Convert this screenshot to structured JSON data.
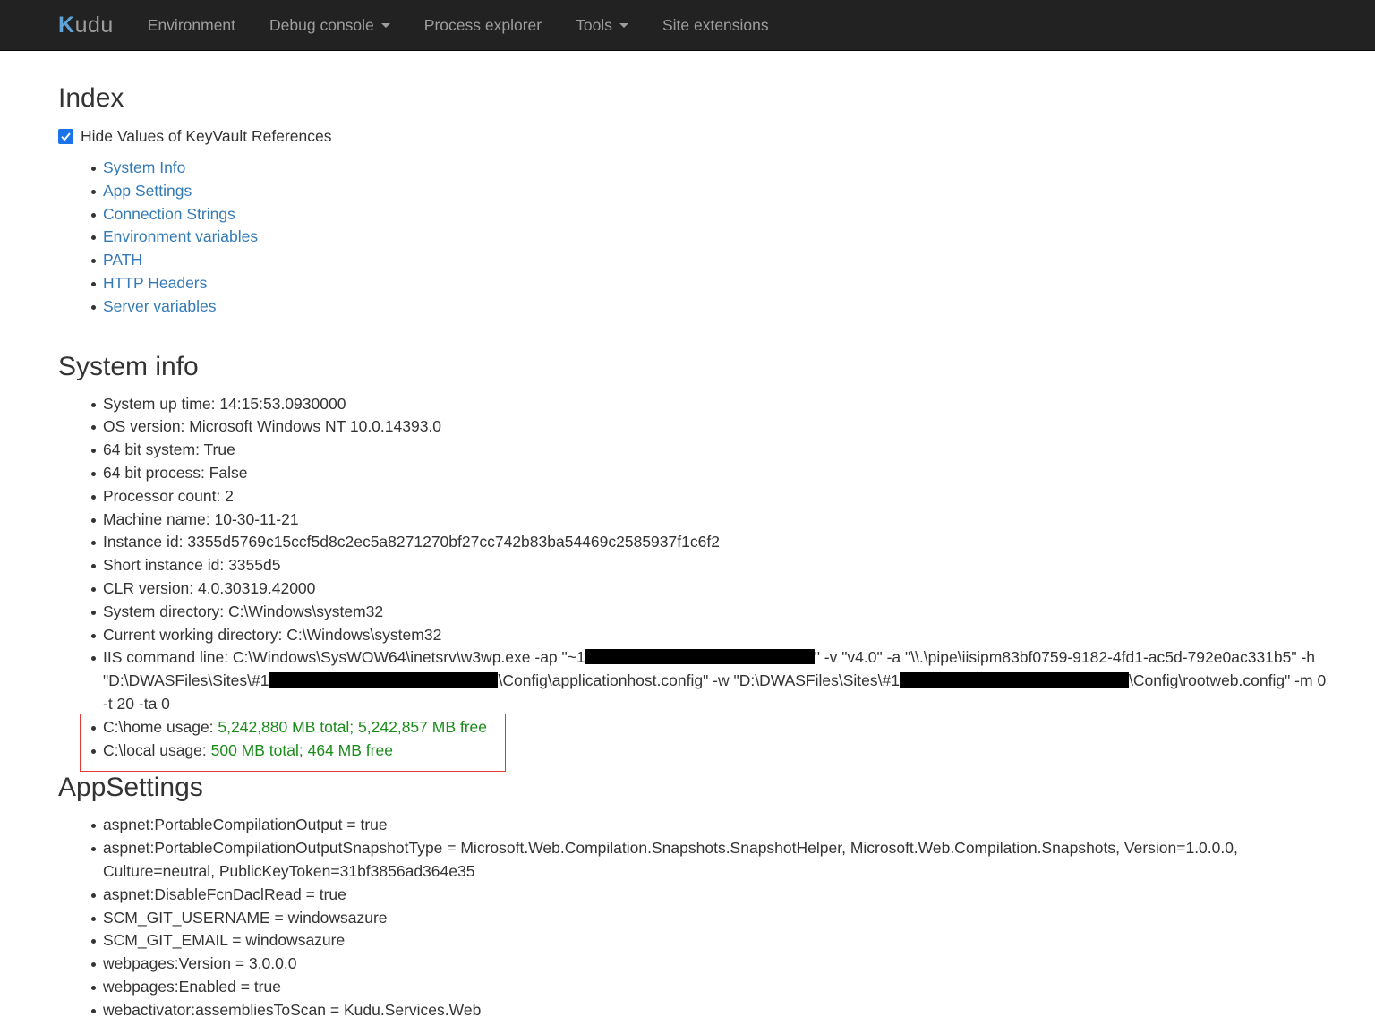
{
  "nav": {
    "brand": "udu",
    "brand_k": "K",
    "items": [
      {
        "label": "Environment",
        "dropdown": false
      },
      {
        "label": "Debug console",
        "dropdown": true
      },
      {
        "label": "Process explorer",
        "dropdown": false
      },
      {
        "label": "Tools",
        "dropdown": true
      },
      {
        "label": "Site extensions",
        "dropdown": false
      }
    ]
  },
  "index": {
    "title": "Index",
    "checkbox_label": "Hide Values of KeyVault References",
    "checkbox_checked": true,
    "links": [
      "System Info",
      "App Settings",
      "Connection Strings",
      "Environment variables",
      "PATH",
      "HTTP Headers",
      "Server variables"
    ]
  },
  "system_info": {
    "title": "System info",
    "items": [
      "System up time: 14:15:53.0930000",
      "OS version: Microsoft Windows NT 10.0.14393.0",
      "64 bit system: True",
      "64 bit process: False",
      "Processor count: 2",
      "Machine name: 10-30-11-21",
      "Instance id: 3355d5769c15ccf5d8c2ec5a8271270bf27cc742b83ba54469c2585937f1c6f2",
      "Short instance id: 3355d5",
      "CLR version: 4.0.30319.42000",
      "System directory: C:\\Windows\\system32",
      "Current working directory: C:\\Windows\\system32"
    ],
    "iis": {
      "p1": "IIS command line: C:\\Windows\\SysWOW64\\inetsrv\\w3wp.exe -ap \"~1",
      "p2": "\" -v \"v4.0\" -a \"\\\\.\\pipe\\iisipm83bf0759-9182-4fd1-ac5d-792e0ac331b5\" -h",
      "p3": "\"D:\\DWASFiles\\Sites\\#1",
      "p4": "\\Config\\applicationhost.config\" -w \"D:\\DWASFiles\\Sites\\#1",
      "p5": "\\Config\\rootweb.config\" -m 0",
      "p6": "-t 20 -ta 0"
    },
    "home_usage": {
      "label": "C:\\home usage: ",
      "value": "5,242,880 MB total; 5,242,857 MB free"
    },
    "local_usage": {
      "label": "C:\\local usage: ",
      "value": "500 MB total; 464 MB free"
    },
    "highlight_color": "#e53935",
    "usage_color": "#198c19"
  },
  "app_settings": {
    "title": "AppSettings",
    "items": [
      "aspnet:PortableCompilationOutput = true",
      "aspnet:PortableCompilationOutputSnapshotType = Microsoft.Web.Compilation.Snapshots.SnapshotHelper, Microsoft.Web.Compilation.Snapshots, Version=1.0.0.0,",
      "Culture=neutral, PublicKeyToken=31bf3856ad364e35",
      "aspnet:DisableFcnDaclRead = true",
      "SCM_GIT_USERNAME = windowsazure",
      "SCM_GIT_EMAIL = windowsazure",
      "webpages:Version = 3.0.0.0",
      "webpages:Enabled = true",
      "webactivator:assembliesToScan = Kudu.Services.Web"
    ]
  }
}
